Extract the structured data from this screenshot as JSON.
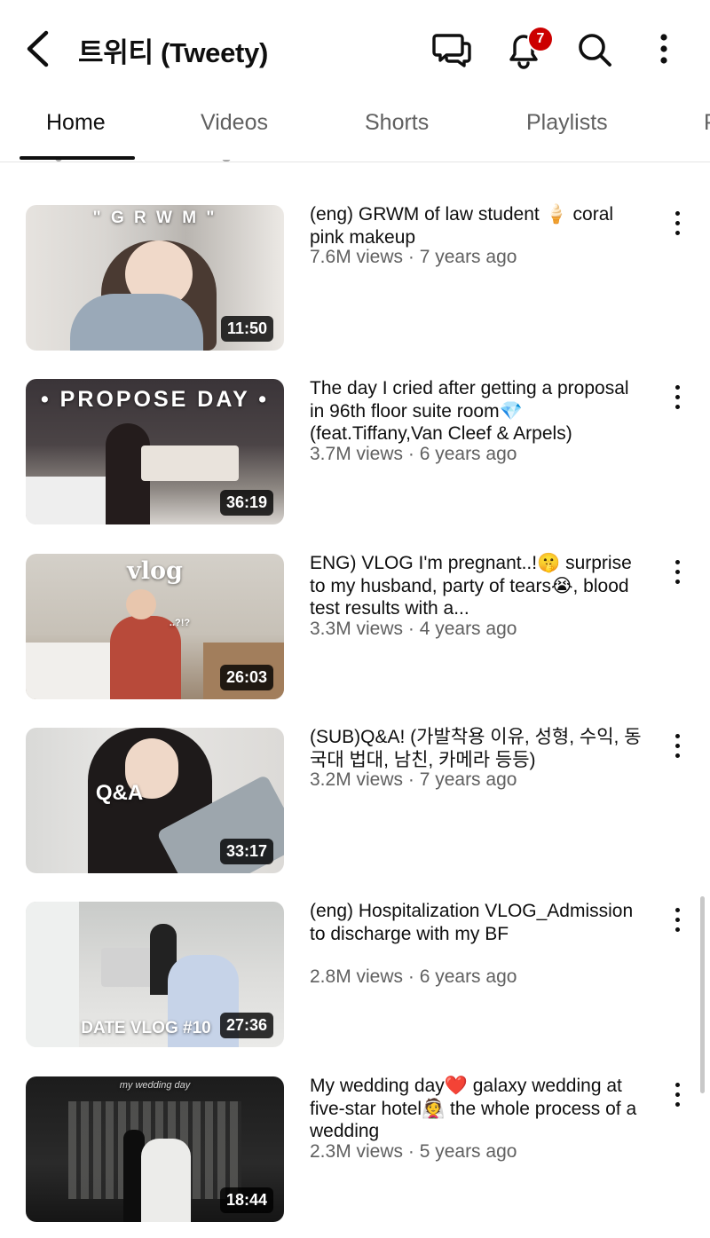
{
  "header": {
    "channel_title": "트위티 (Tweety)",
    "notification_count": "7"
  },
  "tabs": [
    {
      "label": "Home",
      "active": true
    },
    {
      "label": "Videos"
    },
    {
      "label": "Shorts"
    },
    {
      "label": "Playlists"
    },
    {
      "label": "P"
    }
  ],
  "videos": [
    {
      "title": "(eng) GRWM of law student 🍦 coral pink makeup",
      "meta": "7.6M views · 7 years ago",
      "duration": "11:50",
      "overlay": "\" G R W M \""
    },
    {
      "title": "The day I cried after getting a proposal in 96th floor suite room💎 (feat.Tiffany,Van Cleef & Arpels)",
      "meta": "3.7M views · 6 years ago",
      "duration": "36:19",
      "overlay": "• PROPOSE DAY •"
    },
    {
      "title": "ENG) VLOG I'm pregnant..!🤫 surprise to my husband, party of tears😭, blood test results with a...",
      "meta": "3.3M views · 4 years ago",
      "duration": "26:03",
      "overlay": "vlog",
      "overlay_small": "..?!?"
    },
    {
      "title": "(SUB)Q&A! (가발착용 이유, 성형, 수익, 동국대 법대, 남친, 카메라 등등)",
      "meta": "3.2M views · 7 years ago",
      "duration": "33:17",
      "overlay": "Q&A"
    },
    {
      "title": "(eng) Hospitalization VLOG_Admission to discharge with my BF",
      "meta": "2.8M views · 6 years ago",
      "duration": "27:36",
      "overlay": "DATE VLOG #10"
    },
    {
      "title": "My wedding day❤️ galaxy wedding at five-star hotel👰 the whole process of a wedding",
      "meta": "2.3M views · 5 years ago",
      "duration": "18:44",
      "overlay": "my wedding day"
    }
  ],
  "colors": {
    "text_primary": "#0f0f0f",
    "text_secondary": "#606060",
    "badge": "#cc0000"
  }
}
